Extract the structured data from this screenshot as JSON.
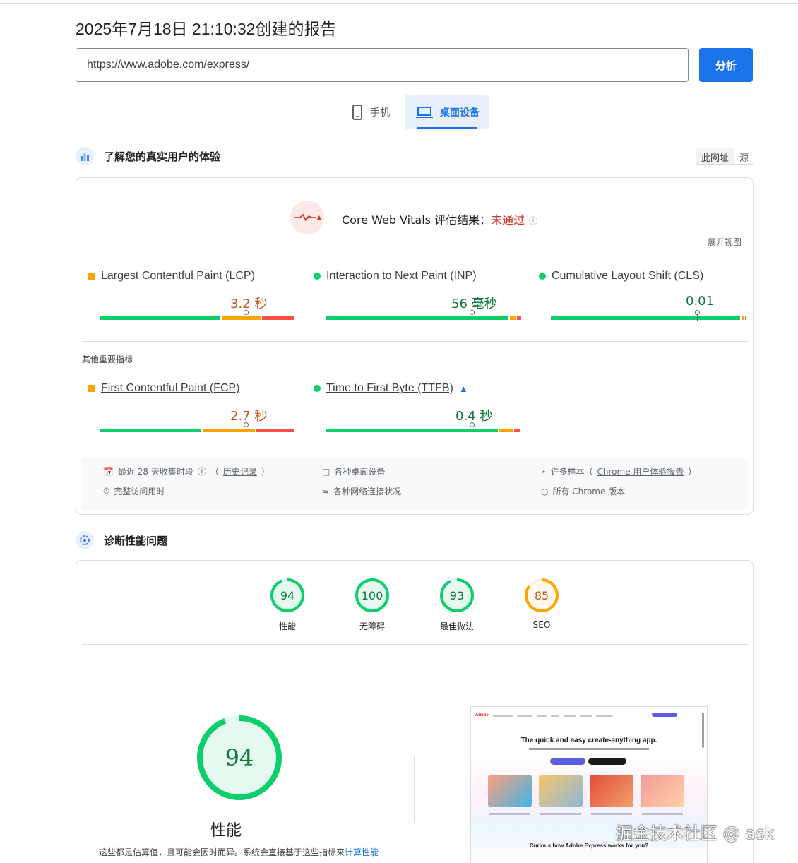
{
  "report_title": "2025年7月18日 21:10:32创建的报告",
  "url_input": {
    "value": "https://www.adobe.com/express/"
  },
  "analyze_label": "分析",
  "tabs": {
    "mobile": "手机",
    "desktop": "桌面设备"
  },
  "crux": {
    "heading": "了解您的真实用户的体验",
    "toggle": {
      "this_url": "此网址",
      "origin": "源"
    },
    "cwv_label": "Core Web Vitals 评估结果：",
    "cwv_status": "未通过",
    "expand_view": "展开视图",
    "metrics": [
      {
        "name": "Largest Contentful Paint (LCP)",
        "value": "3.2 秒",
        "status": "needs-improvement"
      },
      {
        "name": "Interaction to Next Paint (INP)",
        "value": "56 毫秒",
        "status": "good"
      },
      {
        "name": "Cumulative Layout Shift (CLS)",
        "value": "0.01",
        "status": "good"
      }
    ],
    "other_label": "其他重要指标",
    "other_metrics": [
      {
        "name": "First Contentful Paint (FCP)",
        "value": "2.7 秒",
        "status": "needs-improvement"
      },
      {
        "name": "Time to First Byte (TTFB)",
        "value": "0.4 秒",
        "status": "good"
      }
    ],
    "footer": {
      "period": "最近 28 天收集时段",
      "history": "历史记录",
      "devices": "各种桌面设备",
      "samples_prefix": "许多样本（",
      "samples_link": "Chrome 用户体验报告",
      "samples_suffix": "）",
      "full_visit": "完整访问用时",
      "network": "各种网络连接状况",
      "chrome": "所有 Chrome 版本"
    }
  },
  "diagnose": {
    "heading": "诊断性能问题",
    "scores": [
      {
        "label": "性能",
        "score": "94",
        "color": "#0cce6b"
      },
      {
        "label": "无障碍",
        "score": "100",
        "color": "#0cce6b"
      },
      {
        "label": "最佳做法",
        "score": "93",
        "color": "#0cce6b"
      },
      {
        "label": "SEO",
        "score": "85",
        "color": "#ffa400"
      }
    ],
    "big_score": "94",
    "big_label": "性能",
    "note_prefix": "这些都是估算值，且可能会因时而异。系统会直接基于这些指标来",
    "note_link": "计算性能",
    "screenshot": {
      "logo": "Adobe",
      "headline": "The quick and easy create-anything app.",
      "subheadline": "Curious how Adobe Express works for you?"
    }
  },
  "watermark": "掘金技术社区 @ ask"
}
